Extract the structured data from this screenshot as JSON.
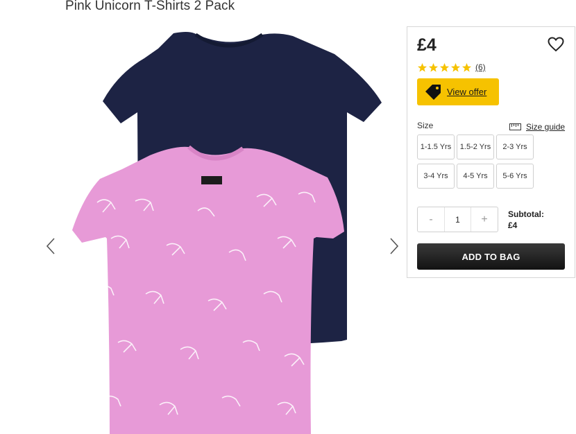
{
  "product": {
    "title": "Pink Unicorn T-Shirts 2 Pack"
  },
  "gallery": {
    "prev_icon": "chevron-left-icon",
    "next_icon": "chevron-right-icon",
    "colors": {
      "navy": "#1d2344",
      "pink": "#e79ad7"
    }
  },
  "panel": {
    "price": "£4",
    "rating": {
      "stars": 5,
      "count_label": "(6)",
      "star_color": "#f6c200"
    },
    "offer": {
      "label": "View offer",
      "color": "#f6c200"
    },
    "size": {
      "label": "Size",
      "guide_label": "Size guide",
      "options": [
        "1-1.5 Yrs",
        "1.5-2 Yrs",
        "2-3 Yrs",
        "3-4 Yrs",
        "4-5 Yrs",
        "5-6 Yrs"
      ]
    },
    "quantity": {
      "minus": "-",
      "value": "1",
      "plus": "+"
    },
    "subtotal": {
      "label": "Subtotal:",
      "value": "£4"
    },
    "add_to_bag": "ADD TO BAG"
  }
}
